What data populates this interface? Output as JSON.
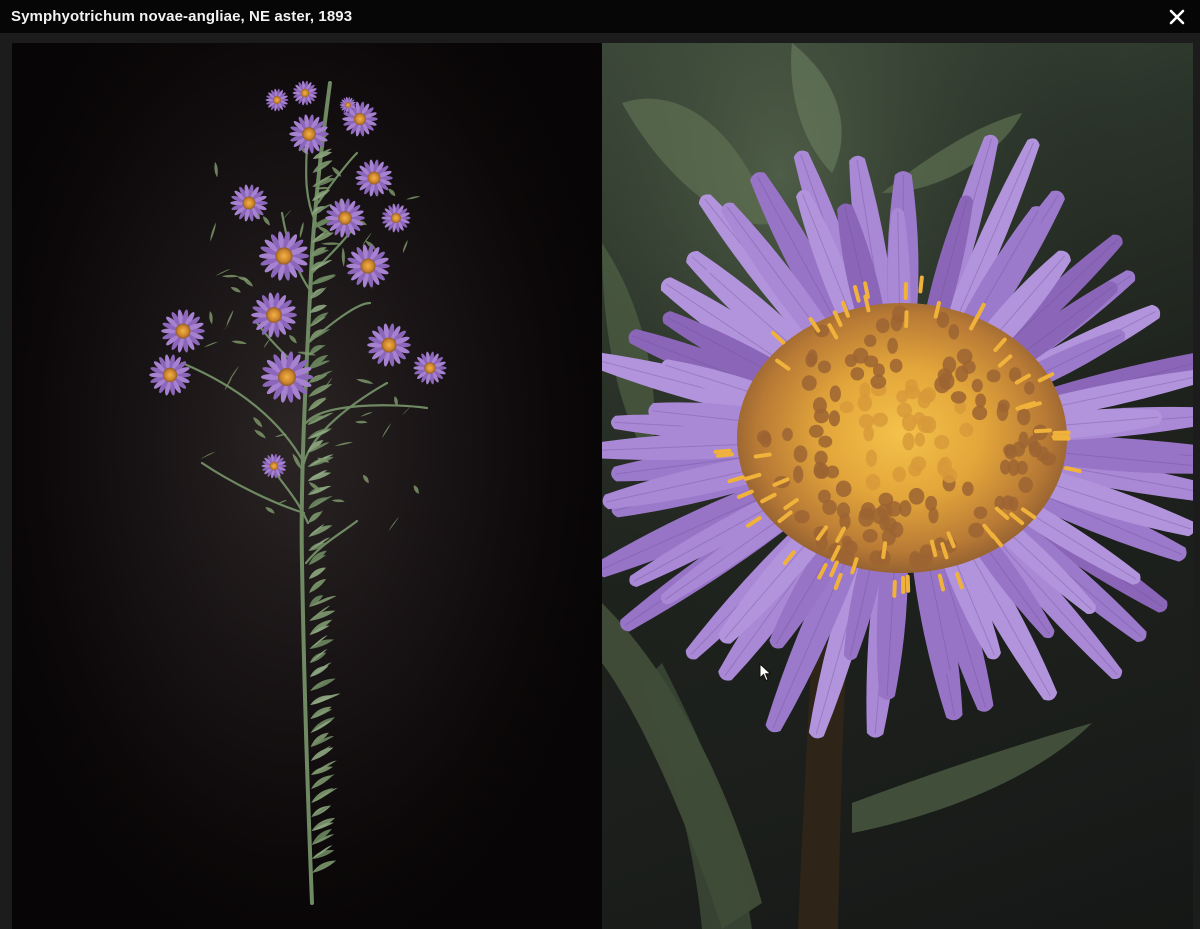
{
  "window": {
    "title": "Symphyotrichum novae-angliae, NE aster, 1893",
    "close_icon": "close-icon"
  },
  "images": {
    "left": {
      "subject": "whole-plant-photo"
    },
    "right": {
      "subject": "flower-closeup-photo"
    }
  },
  "colors": {
    "titlebar": "#060606",
    "petal": "#9a73c4",
    "center": "#e3a83a",
    "stem": "#6f8a63"
  }
}
